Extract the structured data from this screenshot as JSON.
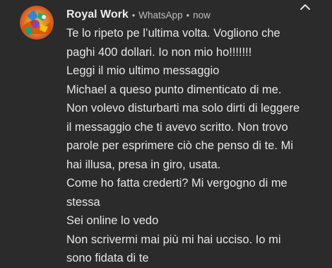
{
  "notification": {
    "sender": "Royal Work",
    "app": "WhatsApp",
    "time": "now",
    "separator": "•",
    "lines": [
      "Te lo ripeto pe l’ultima volta. Vogliono che",
      "paghi 400 dollari. Io non mio ho!!!!!!!",
      "Leggi il mio ultimo messaggio",
      "Michael  a queso punto dimenticato di me.",
      "Non volevo disturbarti ma solo dirti di leggere",
      "il messaggio che ti avevo scritto. Non trovo",
      "parole per esprimere  ciò che penso di te. Mi",
      "hai illusa, presa in giro, usata.",
      "Come ho fatta crederti? Mi vergogno di me",
      "stessa",
      "Sei online lo vedo",
      "Non scrivermi mai più mi hai ucciso. Io mi",
      "sono fidata di te"
    ],
    "icons": {
      "avatar": "colorful-logo-avatar",
      "collapse": "chevron-up-icon"
    }
  }
}
